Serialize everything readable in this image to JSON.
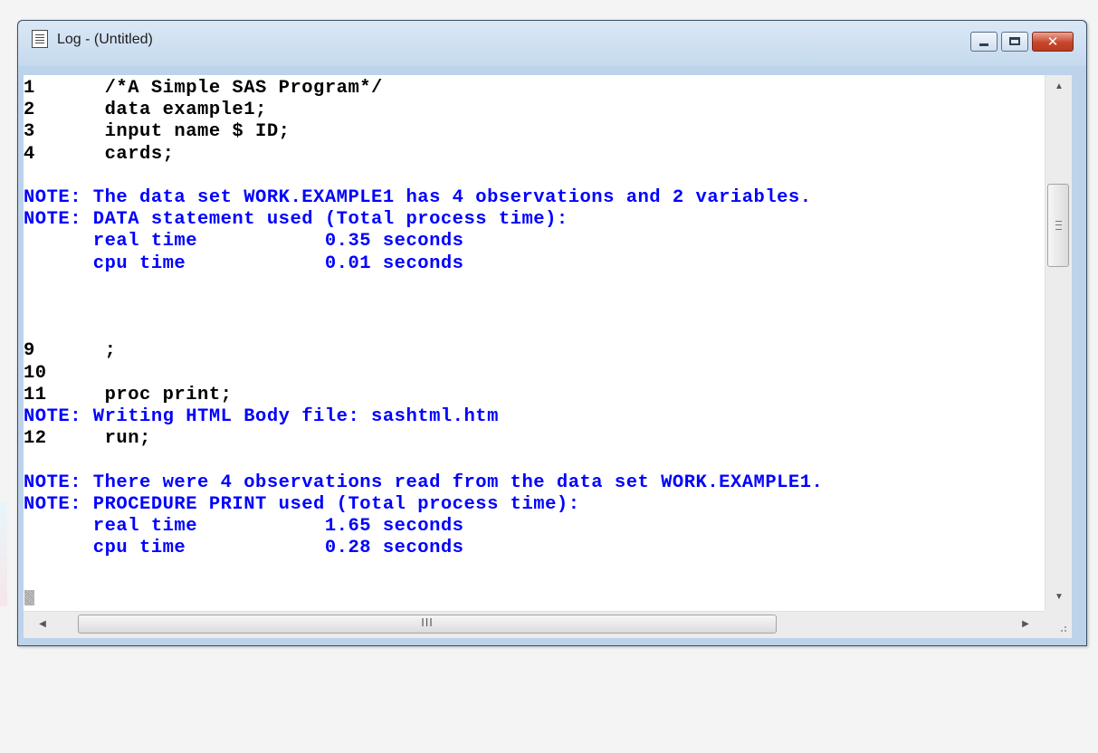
{
  "window": {
    "title": "Log - (Untitled)",
    "icon": "notepad-icon",
    "buttons": {
      "minimize": "minimize-icon",
      "maximize": "maximize-icon",
      "close": "close-icon"
    }
  },
  "log": {
    "lines": [
      {
        "kind": "src",
        "text": "1      /*A Simple SAS Program*/"
      },
      {
        "kind": "src",
        "text": "2      data example1;"
      },
      {
        "kind": "src",
        "text": "3      input name $ ID;"
      },
      {
        "kind": "src",
        "text": "4      cards;"
      },
      {
        "kind": "blank",
        "text": ""
      },
      {
        "kind": "note",
        "text": "NOTE: The data set WORK.EXAMPLE1 has 4 observations and 2 variables."
      },
      {
        "kind": "note",
        "text": "NOTE: DATA statement used (Total process time):"
      },
      {
        "kind": "note",
        "text": "      real time           0.35 seconds"
      },
      {
        "kind": "note",
        "text": "      cpu time            0.01 seconds"
      },
      {
        "kind": "blank",
        "text": ""
      },
      {
        "kind": "blank",
        "text": ""
      },
      {
        "kind": "blank",
        "text": ""
      },
      {
        "kind": "src",
        "text": "9      ;"
      },
      {
        "kind": "src",
        "text": "10"
      },
      {
        "kind": "src",
        "text": "11     proc print;"
      },
      {
        "kind": "note",
        "text": "NOTE: Writing HTML Body file: sashtml.htm"
      },
      {
        "kind": "src",
        "text": "12     run;"
      },
      {
        "kind": "blank",
        "text": ""
      },
      {
        "kind": "note",
        "text": "NOTE: There were 4 observations read from the data set WORK.EXAMPLE1."
      },
      {
        "kind": "note",
        "text": "NOTE: PROCEDURE PRINT used (Total process time):"
      },
      {
        "kind": "note",
        "text": "      real time           1.65 seconds"
      },
      {
        "kind": "note",
        "text": "      cpu time            0.28 seconds"
      }
    ]
  },
  "scrollbars": {
    "vertical": {
      "up": "scroll-up-arrow-icon",
      "down": "scroll-down-arrow-icon",
      "grip": "grip-lines-icon"
    },
    "horizontal": {
      "left": "scroll-left-arrow-icon",
      "right": "scroll-right-arrow-icon",
      "thumb_grip": "III"
    }
  }
}
